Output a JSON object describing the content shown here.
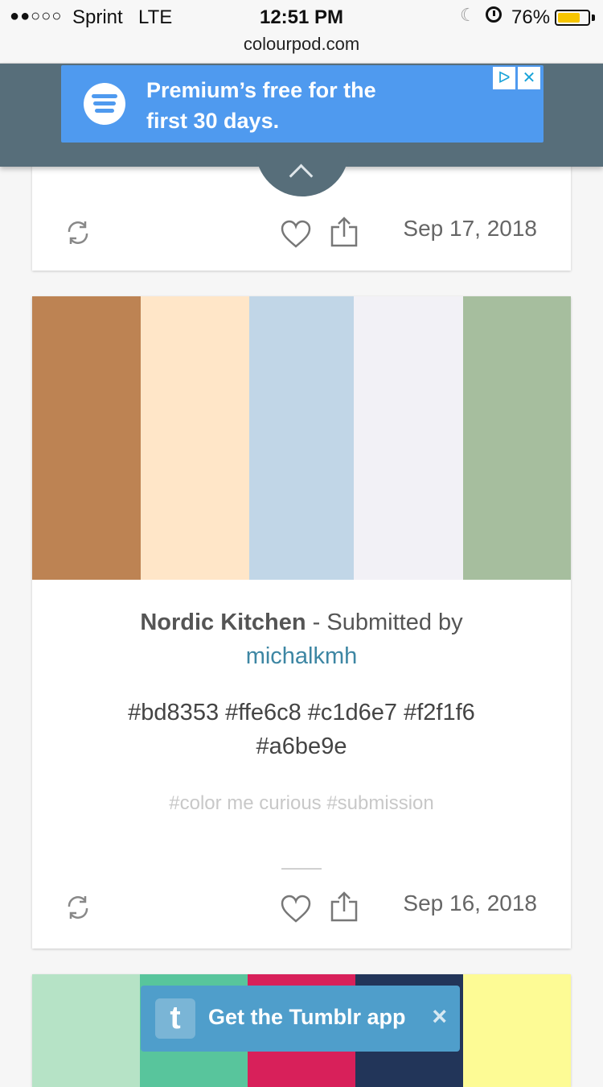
{
  "status": {
    "signal": "●●○○○",
    "carrier": "Sprint",
    "network": "LTE",
    "time": "12:51 PM",
    "battery_pct": "76%",
    "battery_level": 0.76
  },
  "url": "colourpod.com",
  "ad": {
    "text": "Premium’s free for the first 30 days.",
    "adchoices_glyph": "ᐅ",
    "close_glyph": "✕",
    "bg_color": "#4f9aef"
  },
  "card1": {
    "date": "Sep 17, 2018"
  },
  "card2": {
    "palette": [
      "#bd8353",
      "#ffe6c8",
      "#c1d6e7",
      "#f2f1f6",
      "#a6be9e"
    ],
    "title": "Nordic Kitchen",
    "separator": " - ",
    "submitted_by": "Submitted by",
    "user": "michalkmh",
    "hex_line1": "#bd8353 #ffe6c8 #c1d6e7 #f2f1f6",
    "hex_line2": "#a6be9e",
    "tags": "#color me curious #submission",
    "date": "Sep 16, 2018"
  },
  "card3": {
    "palette": [
      "#b6e3c6",
      "#58c59c",
      "#d8205a",
      "#223559",
      "#fdfb95"
    ]
  },
  "tumblr_bar": {
    "logo": "t",
    "text": "Get the Tumblr app",
    "close": "×",
    "bg_color": "#4f9ecb"
  }
}
